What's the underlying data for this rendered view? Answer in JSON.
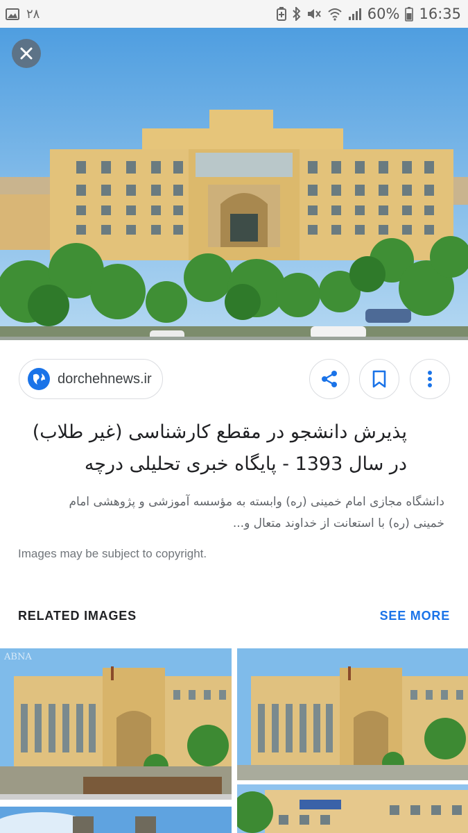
{
  "status_bar": {
    "notification_count": "۲۸",
    "battery": "60%",
    "time": "16:35"
  },
  "hero": {
    "close_icon": "close-icon"
  },
  "source": {
    "site": "dorchehnews.ir",
    "icon": "globe-icon"
  },
  "actions": [
    {
      "name": "share",
      "icon": "share-icon"
    },
    {
      "name": "save",
      "icon": "bookmark-icon"
    },
    {
      "name": "more",
      "icon": "more-vert-icon"
    }
  ],
  "result": {
    "title_line1": "پذیرش دانشجو در مقطع کارشناسی (غیر طلاب)",
    "title_line2": "در سال 1393 - پایگاه خبری تحلیلی درچه",
    "snippet_line1": "دانشگاه مجازی امام خمینی (ره) وابسته به مؤسسه آموزشی و پژوهشی امام",
    "snippet_line2": "خمینی (ره) با استعانت از خداوند متعال و...",
    "copyright": "Images may be subject to copyright."
  },
  "related": {
    "title": "RELATED IMAGES",
    "see_more": "SEE MORE",
    "watermark": "ABNA"
  },
  "colors": {
    "accent": "#1a73e8",
    "building": "#e6c57a",
    "sky": "#6fb2e6"
  }
}
